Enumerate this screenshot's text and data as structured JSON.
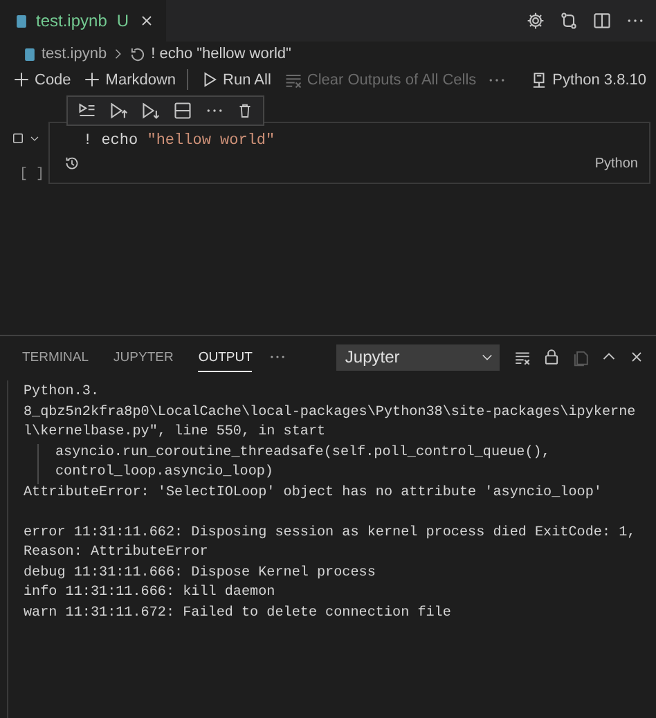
{
  "editor_tabs": [
    {
      "title": "test.ipynb",
      "decoration": "U",
      "selected": true
    }
  ],
  "breadcrumb": {
    "file": "test.ipynb",
    "cell": "! echo \"hellow world\""
  },
  "toolbar": {
    "items": [
      {
        "kind": "add",
        "label": "Code",
        "disabled": false
      },
      {
        "kind": "add",
        "label": "Markdown",
        "disabled": false
      },
      {
        "kind": "run",
        "label": "Run All",
        "disabled": false
      },
      {
        "kind": "clear",
        "label": "Clear Outputs of All Cells",
        "disabled": true
      }
    ],
    "kernel": "Python 3.8.10"
  },
  "cell": {
    "execution_count": "[ ]",
    "code": [
      {
        "text": "! echo ",
        "kind": "plain"
      },
      {
        "text": "\"hellow world\"",
        "kind": "string"
      }
    ],
    "language": "Python"
  },
  "panel": {
    "tabs": [
      {
        "label": "TERMINAL",
        "selected": false
      },
      {
        "label": "JUPYTER",
        "selected": false
      },
      {
        "label": "OUTPUT",
        "selected": true
      }
    ],
    "channel": "Jupyter",
    "output_blocks": [
      [
        {
          "text": "Python.3.",
          "indented": false
        },
        {
          "text": "8_qbz5n2kfra8p0\\LocalCache\\local-packages\\Python38\\site-packages\\ipykerne",
          "indented": false
        },
        {
          "text": "l\\kernelbase.py\", line 550, in start",
          "indented": false
        },
        {
          "text": "asyncio.run_coroutine_threadsafe(self.poll_control_queue(),",
          "indented": true
        },
        {
          "text": "control_loop.asyncio_loop)",
          "indented": true
        },
        {
          "text": "AttributeError: 'SelectIOLoop' object has no attribute 'asyncio_loop'",
          "indented": false
        }
      ],
      [
        {
          "text": "error 11:31:11.662: Disposing session as kernel process died ExitCode: 1,",
          "indented": false
        },
        {
          "text": "Reason: AttributeError",
          "indented": false
        },
        {
          "text": "debug 11:31:11.666: Dispose Kernel process",
          "indented": false
        },
        {
          "text": "info 11:31:11.666: kill daemon",
          "indented": false
        },
        {
          "text": "warn 11:31:11.672: Failed to delete connection file",
          "indented": false
        }
      ]
    ]
  }
}
